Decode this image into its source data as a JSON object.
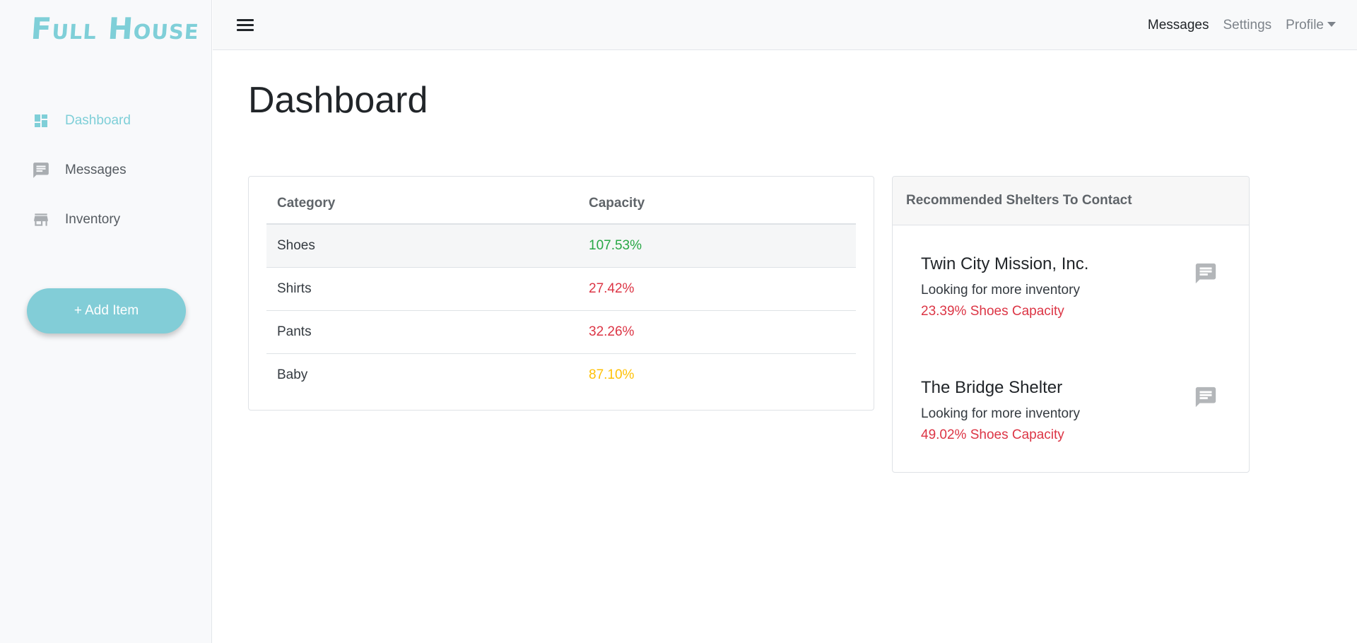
{
  "sidebar": {
    "logo_text": "Full House",
    "items": [
      {
        "label": "Dashboard",
        "icon": "dashboard-icon",
        "active": true
      },
      {
        "label": "Messages",
        "icon": "message-icon",
        "active": false
      },
      {
        "label": "Inventory",
        "icon": "store-icon",
        "active": false
      }
    ],
    "add_button_label": "+ Add Item"
  },
  "topbar": {
    "menu_icon": "hamburger-menu-icon",
    "links": {
      "messages": "Messages",
      "settings": "Settings",
      "profile": "Profile"
    }
  },
  "main": {
    "title": "Dashboard",
    "capacity_table": {
      "headers": [
        "Category",
        "Capacity"
      ],
      "rows": [
        {
          "category": "Shoes",
          "capacity": "107.53%",
          "status_color": "#28a745"
        },
        {
          "category": "Shirts",
          "capacity": "27.42%",
          "status_color": "#dc3545"
        },
        {
          "category": "Pants",
          "capacity": "32.26%",
          "status_color": "#dc3545"
        },
        {
          "category": "Baby",
          "capacity": "87.10%",
          "status_color": "#ffc107"
        }
      ]
    },
    "shelters": {
      "header": "Recommended Shelters To Contact",
      "items": [
        {
          "name": "Twin City Mission, Inc.",
          "description": "Looking for more inventory",
          "capacity": "23.39% Shoes Capacity",
          "icon": "message-icon"
        },
        {
          "name": "The Bridge Shelter",
          "description": "Looking for more inventory",
          "capacity": "49.02% Shoes Capacity",
          "icon": "message-icon"
        }
      ]
    }
  },
  "colors": {
    "accent": "#7fcfd8",
    "success": "#28a745",
    "danger": "#dc3545",
    "warning": "#ffc107"
  }
}
